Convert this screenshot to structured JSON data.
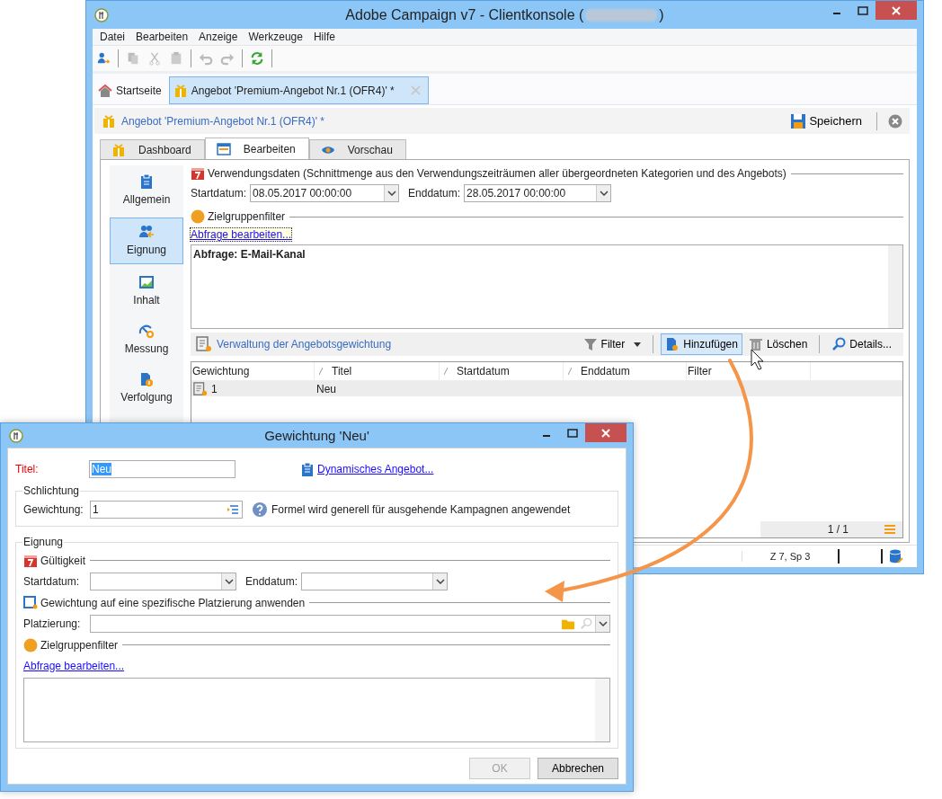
{
  "main_window": {
    "title": "Adobe Campaign v7 - Clientkonsole (",
    "title_end": ")",
    "menu": [
      "Datei",
      "Bearbeiten",
      "Anzeige",
      "Werkzeuge",
      "Hilfe"
    ],
    "doc_tabs": [
      {
        "label": "Startseite",
        "kind": "home",
        "selected": false
      },
      {
        "label": "Angebot 'Premium-Angebot Nr.1 (OFR4)' *",
        "kind": "offer",
        "selected": true
      }
    ],
    "header": {
      "title": "Angebot 'Premium-Angebot Nr.1 (OFR4)' *",
      "save": "Speichern"
    },
    "tabs": [
      {
        "label": "Dashboard",
        "kind": "gift",
        "selected": false
      },
      {
        "label": "Bearbeiten",
        "kind": "window",
        "selected": true
      },
      {
        "label": "Vorschau",
        "kind": "eye",
        "selected": false
      }
    ],
    "sidebar": [
      {
        "label": "Allgemein",
        "kind": "clipboard",
        "selected": false
      },
      {
        "label": "Eignung",
        "kind": "people",
        "selected": true
      },
      {
        "label": "Inhalt",
        "kind": "image",
        "selected": false
      },
      {
        "label": "Messung",
        "kind": "gauge",
        "selected": false
      },
      {
        "label": "Verfolgung",
        "kind": "tracking",
        "selected": false
      }
    ],
    "usage": {
      "heading": "Verwendungsdaten (Schnittmenge aus den Verwendungszeiträumen aller übergeordneten Kategorien und des Angebots)",
      "start_label": "Startdatum:",
      "start": "08.05.2017 00:00:00",
      "end_label": "Enddatum:",
      "end": "28.05.2017 00:00:00"
    },
    "target_filter": {
      "heading": "Zielgruppenfilter",
      "link": "Abfrage bearbeiten...",
      "query": "Abfrage: E-Mail-Kanal"
    },
    "weighting": {
      "title": "Verwaltung der Angebotsgewichtung",
      "actions": [
        {
          "kind": "filter",
          "label": "Filter",
          "hovered": false
        },
        {
          "kind": "add",
          "label": "Hinzufügen",
          "hovered": true
        },
        {
          "kind": "delete",
          "label": "Löschen",
          "hovered": false
        },
        {
          "kind": "details",
          "label": "Details...",
          "hovered": false
        }
      ],
      "columns": [
        {
          "label": "Gewichtung",
          "sortable": false
        },
        {
          "label": "Titel",
          "sortable": true
        },
        {
          "label": "Startdatum",
          "sortable": true
        },
        {
          "label": "Enddatum",
          "sortable": true
        },
        {
          "label": "Filter",
          "sortable": false
        }
      ],
      "rows": [
        {
          "weight": "1",
          "title": "Neu"
        }
      ],
      "pager": "1 / 1"
    },
    "status": {
      "position": "Z 7, Sp 3"
    }
  },
  "dialog": {
    "title": "Gewichtung 'Neu'",
    "title_label": "Titel:",
    "title_value": "Neu",
    "title_value_selected": true,
    "link": "Dynamisches Angebot...",
    "arbitration": {
      "legend": "Schlichtung",
      "label": "Gewichtung:",
      "value": "1",
      "hint": "Formel wird generell für ausgehende Kampagnen angewendet"
    },
    "eligibility": {
      "legend": "Eignung",
      "validity": "Gültigkeit",
      "start_label": "Startdatum:",
      "end_label": "Enddatum:",
      "placement_heading": "Gewichtung auf eine spezifische Platzierung anwenden",
      "placement_label": "Platzierung:",
      "filter_heading": "Zielgruppenfilter",
      "link": "Abfrage bearbeiten..."
    },
    "buttons": [
      {
        "label": "OK",
        "disabled": true
      },
      {
        "label": "Abbrechen",
        "disabled": false
      }
    ]
  }
}
